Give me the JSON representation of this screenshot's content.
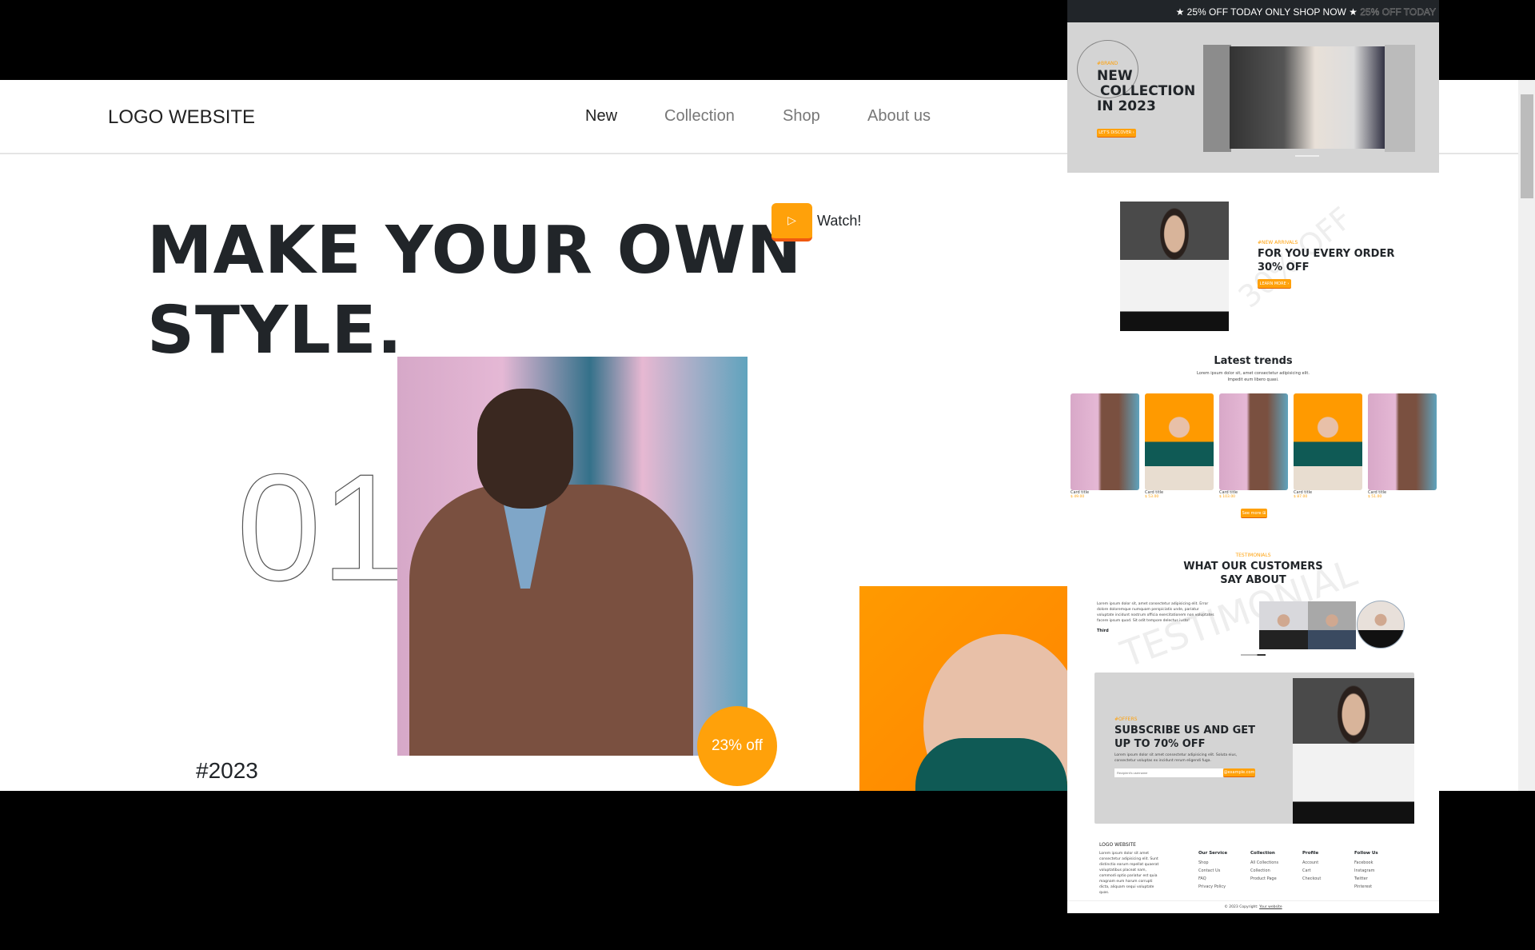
{
  "header": {
    "logo": "LOGO WEBSITE",
    "nav": [
      {
        "label": "New",
        "active": true
      },
      {
        "label": "Collection"
      },
      {
        "label": "Shop"
      },
      {
        "label": "About us"
      }
    ]
  },
  "hero": {
    "headline_line1": "MAKE YOUR OWN",
    "headline_line2": "STYLE.",
    "watch_label": "Watch!",
    "slide_number": "01",
    "discount_badge": "23% off",
    "year_tag": "#2023"
  },
  "preview": {
    "announcement": "★ 25% OFF TODAY ONLY SHOP NOW ★",
    "announcement_ghost": "25% OFF TODAY",
    "banner": {
      "tag": "#BRAND",
      "line1": "NEW",
      "line2": "COLLECTION",
      "line3": "IN 2023",
      "button": "LET'S DISCOVER ›"
    },
    "arrivals": {
      "tag": "#NEW ARRIVALS",
      "line1": "FOR YOU EVERY ORDER",
      "line2": "30% OFF",
      "button": "LEARN MORE ›",
      "watermark": "30% OFF"
    },
    "trends": {
      "title": "Latest trends",
      "subtitle1": "Lorem ipsum dolor sit, amet consectetur adipisicing elit.",
      "subtitle2": "Impedit eum libero quasi.",
      "cards": [
        {
          "title": "Card title",
          "price": "$ 49.00",
          "img": "man"
        },
        {
          "title": "Card title",
          "price": "$ 53.00",
          "img": "girl"
        },
        {
          "title": "Card title",
          "price": "$ 103.00",
          "img": "man"
        },
        {
          "title": "Card title",
          "price": "$ 87.00",
          "img": "girl"
        },
        {
          "title": "Card title",
          "price": "$ 51.00",
          "img": "man"
        }
      ],
      "button": "See more ⊞"
    },
    "testimonials": {
      "tag": "TESTIMONIALS",
      "line1": "WHAT OUR CUSTOMERS",
      "line2": "SAY ABOUT",
      "watermark": "TESTIMONIAL",
      "quote": "Lorem ipsum dolor sit, amet consectetur adipisicing elit. Error dolore doloremque numquam perspiciatis unde, pariatur voluptate incidunt nostrum officia exercitationem non voluptates facere ipsum quod. Sit odit tempore delectus iusto!",
      "author": "Third"
    },
    "subscribe": {
      "tag": "#OFFERS",
      "line1": "SUBSCRIBE US AND GET",
      "line2": "UP TO 70% OFF",
      "text": "Lorem ipsum dolor sit amet consectetur adipisicing elit. Soluta eius, consectetur voluptas ex incidunt rerum eligendi fuga.",
      "placeholder": "Recipient's username",
      "button": "@example.com"
    },
    "footer": {
      "logo": "LOGO WEBSITE",
      "about": "Lorem ipsum dolor sit amet consectetur adipisicing elit. Sunt distinctio earum repellat quaerat voluptatibus placeat nam, commodi optio pariatur est quia magnam eum harum corrupti dicta, aliquam sequi voluptate quas.",
      "columns": [
        {
          "title": "Our Service",
          "links": [
            "Shop",
            "Contact Us",
            "FAQ",
            "Privacy Policy"
          ]
        },
        {
          "title": "Collection",
          "links": [
            "All Collections",
            "Collection",
            "Product Page"
          ]
        },
        {
          "title": "Profile",
          "links": [
            "Account",
            "Cart",
            "Checkout"
          ]
        },
        {
          "title": "Follow Us",
          "links": [
            "Facebook",
            "Instagram",
            "Twitter",
            "Pinterest"
          ]
        }
      ],
      "copyright": "© 2023 Copyright:",
      "copyright_link": "Your website"
    }
  },
  "colors": {
    "accent": "#ffa10a",
    "dark": "#212529"
  }
}
